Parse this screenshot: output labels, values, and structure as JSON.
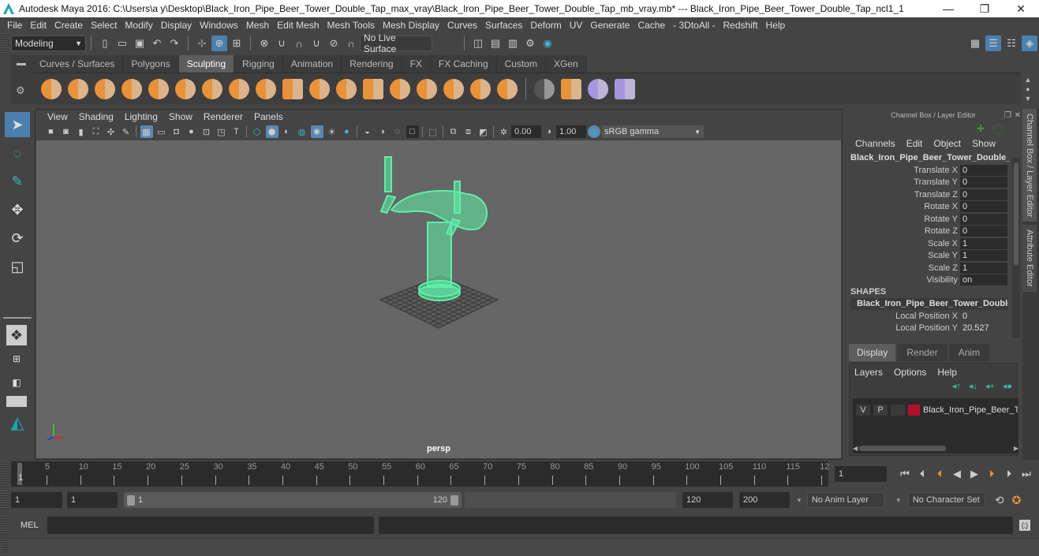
{
  "window": {
    "title": "Autodesk Maya 2016: C:\\Users\\a y\\Desktop\\Black_Iron_Pipe_Beer_Tower_Double_Tap_max_vray\\Black_Iron_Pipe_Beer_Tower_Double_Tap_mb_vray.mb*  ---  Black_Iron_Pipe_Beer_Tower_Double_Tap_ncl1_1",
    "controls": {
      "minimize": "—",
      "maximize": "❐",
      "close": "✕"
    }
  },
  "menubar": [
    "File",
    "Edit",
    "Create",
    "Select",
    "Modify",
    "Display",
    "Windows",
    "Mesh",
    "Edit Mesh",
    "Mesh Tools",
    "Mesh Display",
    "Curves",
    "Surfaces",
    "Deform",
    "UV",
    "Generate",
    "Cache",
    "- 3DtoAll -",
    "Redshift",
    "Help"
  ],
  "statusline": {
    "mode": "Modeling",
    "live_surface": "No Live Surface"
  },
  "shelf": {
    "tabs": [
      "Curves / Surfaces",
      "Polygons",
      "Sculpting",
      "Rigging",
      "Animation",
      "Rendering",
      "FX",
      "FX Caching",
      "Custom",
      "XGen"
    ],
    "active_tab": "Sculpting",
    "sculpt_tools": [
      "sculpt",
      "smooth",
      "relax",
      "grab",
      "pinch",
      "flatten",
      "foamy",
      "spray",
      "repeat",
      "imprint",
      "wax",
      "scrape",
      "fill",
      "knife",
      "smear",
      "bulge",
      "amplify",
      "freeze"
    ],
    "extra_tools": [
      "convert-to-frozen",
      "mesh-displacement",
      "mudbox-send",
      "mudbox-update"
    ]
  },
  "viewport": {
    "menu": [
      "View",
      "Shading",
      "Lighting",
      "Show",
      "Renderer",
      "Panels"
    ],
    "exposure": "0.00",
    "gamma": "1.00",
    "color_space": "sRGB gamma",
    "camera_label": "persp",
    "wireframe_color": "#5ef0a8"
  },
  "channel_box": {
    "title": "Channel Box / Layer Editor",
    "menu": [
      "Channels",
      "Edit",
      "Object",
      "Show"
    ],
    "object_name": "Black_Iron_Pipe_Beer_Tower_Double_T...",
    "attributes": [
      {
        "label": "Translate X",
        "value": "0"
      },
      {
        "label": "Translate Y",
        "value": "0"
      },
      {
        "label": "Translate Z",
        "value": "0"
      },
      {
        "label": "Rotate X",
        "value": "0"
      },
      {
        "label": "Rotate Y",
        "value": "0"
      },
      {
        "label": "Rotate Z",
        "value": "0"
      },
      {
        "label": "Scale X",
        "value": "1"
      },
      {
        "label": "Scale Y",
        "value": "1"
      },
      {
        "label": "Scale Z",
        "value": "1"
      },
      {
        "label": "Visibility",
        "value": "on"
      }
    ],
    "shapes_header": "SHAPES",
    "shape_name": "Black_Iron_Pipe_Beer_Tower_Double...",
    "shape_attributes": [
      {
        "label": "Local Position X",
        "value": "0"
      },
      {
        "label": "Local Position Y",
        "value": "20.527"
      }
    ]
  },
  "side_tabs": [
    "Channel Box / Layer Editor",
    "Attribute Editor"
  ],
  "layer_editor": {
    "tabs": [
      "Display",
      "Render",
      "Anim"
    ],
    "active_tab": "Display",
    "menu": [
      "Layers",
      "Options",
      "Help"
    ],
    "layers": [
      {
        "v": "V",
        "p": "P",
        "color": "#b0102e",
        "name": "Black_Iron_Pipe_Beer_Tower_Double_Tap"
      }
    ]
  },
  "timeline": {
    "ticks": [
      "5",
      "10",
      "15",
      "20",
      "25",
      "30",
      "35",
      "40",
      "45",
      "50",
      "55",
      "60",
      "65",
      "70",
      "75",
      "80",
      "85",
      "90",
      "95",
      "100",
      "105",
      "110",
      "115",
      "12"
    ],
    "current_marker": "1",
    "current_frame": "1"
  },
  "range": {
    "start_time": "1",
    "playback_start": "1",
    "slider_start": "1",
    "slider_end": "120",
    "playback_end": "120",
    "end_time": "200",
    "anim_layer": "No Anim Layer",
    "character_set": "No Character Set"
  },
  "cmdline": {
    "label": "MEL",
    "value": ""
  }
}
